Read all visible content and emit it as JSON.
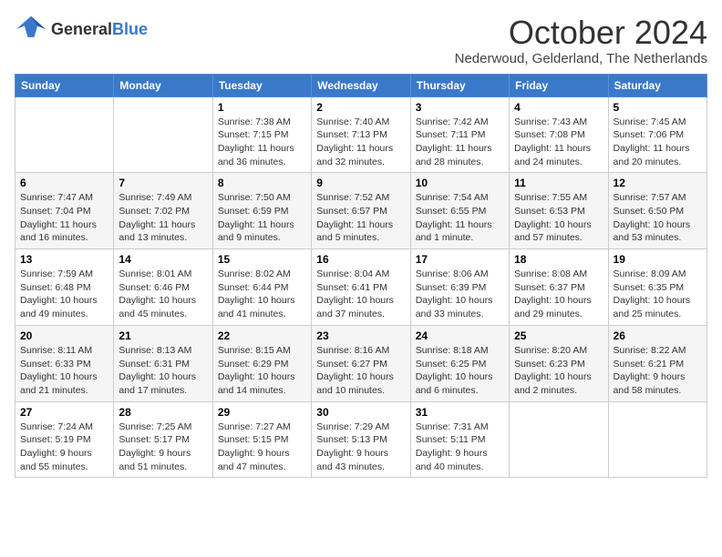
{
  "logo": {
    "line1": "General",
    "line2": "Blue"
  },
  "title": "October 2024",
  "subtitle": "Nederwoud, Gelderland, The Netherlands",
  "headers": [
    "Sunday",
    "Monday",
    "Tuesday",
    "Wednesday",
    "Thursday",
    "Friday",
    "Saturday"
  ],
  "weeks": [
    [
      {
        "day": "",
        "sunrise": "",
        "sunset": "",
        "daylight": ""
      },
      {
        "day": "",
        "sunrise": "",
        "sunset": "",
        "daylight": ""
      },
      {
        "day": "1",
        "sunrise": "Sunrise: 7:38 AM",
        "sunset": "Sunset: 7:15 PM",
        "daylight": "Daylight: 11 hours and 36 minutes."
      },
      {
        "day": "2",
        "sunrise": "Sunrise: 7:40 AM",
        "sunset": "Sunset: 7:13 PM",
        "daylight": "Daylight: 11 hours and 32 minutes."
      },
      {
        "day": "3",
        "sunrise": "Sunrise: 7:42 AM",
        "sunset": "Sunset: 7:11 PM",
        "daylight": "Daylight: 11 hours and 28 minutes."
      },
      {
        "day": "4",
        "sunrise": "Sunrise: 7:43 AM",
        "sunset": "Sunset: 7:08 PM",
        "daylight": "Daylight: 11 hours and 24 minutes."
      },
      {
        "day": "5",
        "sunrise": "Sunrise: 7:45 AM",
        "sunset": "Sunset: 7:06 PM",
        "daylight": "Daylight: 11 hours and 20 minutes."
      }
    ],
    [
      {
        "day": "6",
        "sunrise": "Sunrise: 7:47 AM",
        "sunset": "Sunset: 7:04 PM",
        "daylight": "Daylight: 11 hours and 16 minutes."
      },
      {
        "day": "7",
        "sunrise": "Sunrise: 7:49 AM",
        "sunset": "Sunset: 7:02 PM",
        "daylight": "Daylight: 11 hours and 13 minutes."
      },
      {
        "day": "8",
        "sunrise": "Sunrise: 7:50 AM",
        "sunset": "Sunset: 6:59 PM",
        "daylight": "Daylight: 11 hours and 9 minutes."
      },
      {
        "day": "9",
        "sunrise": "Sunrise: 7:52 AM",
        "sunset": "Sunset: 6:57 PM",
        "daylight": "Daylight: 11 hours and 5 minutes."
      },
      {
        "day": "10",
        "sunrise": "Sunrise: 7:54 AM",
        "sunset": "Sunset: 6:55 PM",
        "daylight": "Daylight: 11 hours and 1 minute."
      },
      {
        "day": "11",
        "sunrise": "Sunrise: 7:55 AM",
        "sunset": "Sunset: 6:53 PM",
        "daylight": "Daylight: 10 hours and 57 minutes."
      },
      {
        "day": "12",
        "sunrise": "Sunrise: 7:57 AM",
        "sunset": "Sunset: 6:50 PM",
        "daylight": "Daylight: 10 hours and 53 minutes."
      }
    ],
    [
      {
        "day": "13",
        "sunrise": "Sunrise: 7:59 AM",
        "sunset": "Sunset: 6:48 PM",
        "daylight": "Daylight: 10 hours and 49 minutes."
      },
      {
        "day": "14",
        "sunrise": "Sunrise: 8:01 AM",
        "sunset": "Sunset: 6:46 PM",
        "daylight": "Daylight: 10 hours and 45 minutes."
      },
      {
        "day": "15",
        "sunrise": "Sunrise: 8:02 AM",
        "sunset": "Sunset: 6:44 PM",
        "daylight": "Daylight: 10 hours and 41 minutes."
      },
      {
        "day": "16",
        "sunrise": "Sunrise: 8:04 AM",
        "sunset": "Sunset: 6:41 PM",
        "daylight": "Daylight: 10 hours and 37 minutes."
      },
      {
        "day": "17",
        "sunrise": "Sunrise: 8:06 AM",
        "sunset": "Sunset: 6:39 PM",
        "daylight": "Daylight: 10 hours and 33 minutes."
      },
      {
        "day": "18",
        "sunrise": "Sunrise: 8:08 AM",
        "sunset": "Sunset: 6:37 PM",
        "daylight": "Daylight: 10 hours and 29 minutes."
      },
      {
        "day": "19",
        "sunrise": "Sunrise: 8:09 AM",
        "sunset": "Sunset: 6:35 PM",
        "daylight": "Daylight: 10 hours and 25 minutes."
      }
    ],
    [
      {
        "day": "20",
        "sunrise": "Sunrise: 8:11 AM",
        "sunset": "Sunset: 6:33 PM",
        "daylight": "Daylight: 10 hours and 21 minutes."
      },
      {
        "day": "21",
        "sunrise": "Sunrise: 8:13 AM",
        "sunset": "Sunset: 6:31 PM",
        "daylight": "Daylight: 10 hours and 17 minutes."
      },
      {
        "day": "22",
        "sunrise": "Sunrise: 8:15 AM",
        "sunset": "Sunset: 6:29 PM",
        "daylight": "Daylight: 10 hours and 14 minutes."
      },
      {
        "day": "23",
        "sunrise": "Sunrise: 8:16 AM",
        "sunset": "Sunset: 6:27 PM",
        "daylight": "Daylight: 10 hours and 10 minutes."
      },
      {
        "day": "24",
        "sunrise": "Sunrise: 8:18 AM",
        "sunset": "Sunset: 6:25 PM",
        "daylight": "Daylight: 10 hours and 6 minutes."
      },
      {
        "day": "25",
        "sunrise": "Sunrise: 8:20 AM",
        "sunset": "Sunset: 6:23 PM",
        "daylight": "Daylight: 10 hours and 2 minutes."
      },
      {
        "day": "26",
        "sunrise": "Sunrise: 8:22 AM",
        "sunset": "Sunset: 6:21 PM",
        "daylight": "Daylight: 9 hours and 58 minutes."
      }
    ],
    [
      {
        "day": "27",
        "sunrise": "Sunrise: 7:24 AM",
        "sunset": "Sunset: 5:19 PM",
        "daylight": "Daylight: 9 hours and 55 minutes."
      },
      {
        "day": "28",
        "sunrise": "Sunrise: 7:25 AM",
        "sunset": "Sunset: 5:17 PM",
        "daylight": "Daylight: 9 hours and 51 minutes."
      },
      {
        "day": "29",
        "sunrise": "Sunrise: 7:27 AM",
        "sunset": "Sunset: 5:15 PM",
        "daylight": "Daylight: 9 hours and 47 minutes."
      },
      {
        "day": "30",
        "sunrise": "Sunrise: 7:29 AM",
        "sunset": "Sunset: 5:13 PM",
        "daylight": "Daylight: 9 hours and 43 minutes."
      },
      {
        "day": "31",
        "sunrise": "Sunrise: 7:31 AM",
        "sunset": "Sunset: 5:11 PM",
        "daylight": "Daylight: 9 hours and 40 minutes."
      },
      {
        "day": "",
        "sunrise": "",
        "sunset": "",
        "daylight": ""
      },
      {
        "day": "",
        "sunrise": "",
        "sunset": "",
        "daylight": ""
      }
    ]
  ]
}
